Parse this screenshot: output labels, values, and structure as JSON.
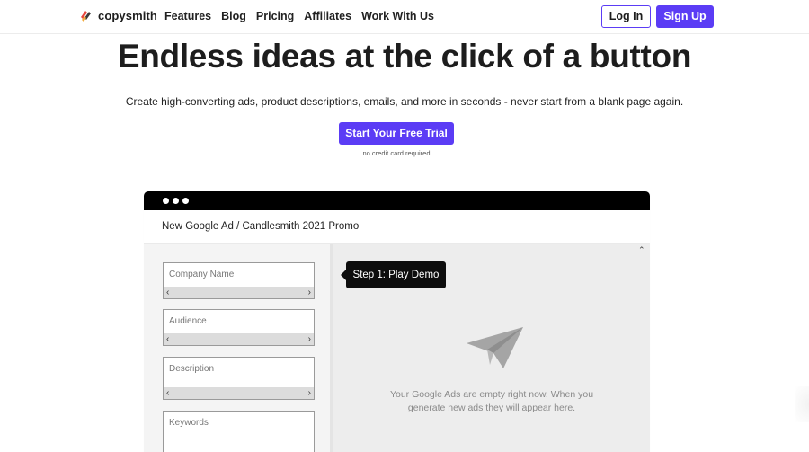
{
  "nav": {
    "logo_text": "copysmith",
    "links": [
      "Features",
      "Blog",
      "Pricing",
      "Affiliates",
      "Work With Us"
    ],
    "login_label": "Log In",
    "signup_label": "Sign Up"
  },
  "hero": {
    "title": "Endless ideas at the click of a button",
    "subtitle": "Create high-converting ads, product descriptions, emails, and more in seconds - never start from a blank page again.",
    "cta_label": "Start Your Free Trial",
    "cta_note": "no credit card required"
  },
  "demo": {
    "breadcrumb": "New Google Ad / Candlesmith 2021 Promo",
    "fields": [
      "Company Name",
      "Audience",
      "Description",
      "Keywords"
    ],
    "tooltip": "Step 1: Play Demo",
    "empty_message_line1": "Your Google Ads are empty right now. When you",
    "empty_message_line2": "generate new ads they will appear here."
  },
  "colors": {
    "accent": "#5b3cf5",
    "titlebar": "#000000",
    "tooltip_bg": "#0d0d0d"
  },
  "icons": {
    "logo": "copysmith-logo-icon",
    "empty_state": "paper-plane-icon",
    "collapse": "chevron-up-icon",
    "scroll_left": "chevron-left-icon",
    "scroll_right": "chevron-right-icon"
  }
}
